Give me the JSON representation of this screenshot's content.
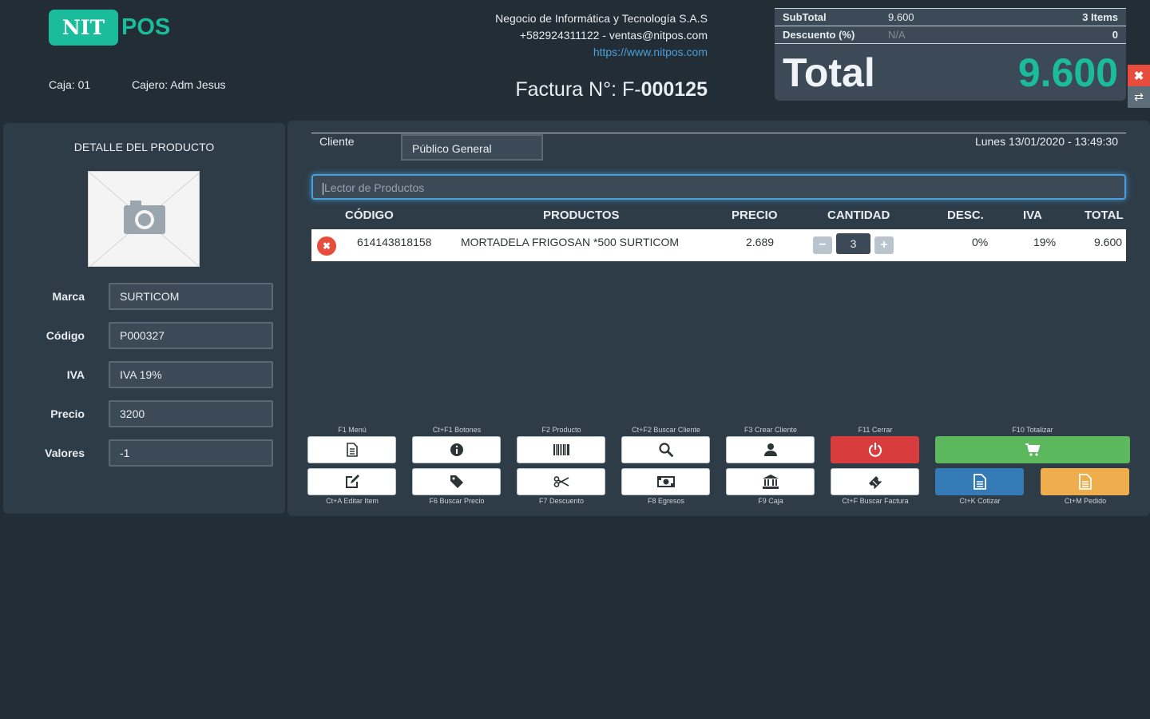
{
  "header": {
    "logo_left": "NIT",
    "logo_right": "POS",
    "caja": "Caja: 01",
    "cajero": "Cajero: Adm Jesus",
    "company_name": "Negocio de Informática y Tecnología S.A.S",
    "company_contact": "+582924311122 - ventas@nitpos.com",
    "company_url": "https://www.nitpos.com",
    "factura_prefix": "Factura N°: F-",
    "factura_number": "000125"
  },
  "totals": {
    "subtotal_label": "SubTotal",
    "subtotal_value": "9.600",
    "items_count": "3 Items",
    "discount_label": "Descuento (%)",
    "discount_value": "N/A",
    "discount_amount": "0",
    "total_label": "Total",
    "total_value": "9.600"
  },
  "product_detail": {
    "title": "DETALLE DEL PRODUCTO",
    "fields": [
      {
        "label": "Marca",
        "value": "SURTICOM"
      },
      {
        "label": "Código",
        "value": "P000327"
      },
      {
        "label": "IVA",
        "value": "IVA 19%"
      },
      {
        "label": "Precio",
        "value": "3200"
      },
      {
        "label": "Valores",
        "value": "-1"
      }
    ]
  },
  "sale": {
    "client_label": "Cliente",
    "client_value": "Público General",
    "datetime": "Lunes 13/01/2020 - 13:49:30",
    "scanner_placeholder": "Lector de Productos",
    "columns": [
      "CÓDIGO",
      "PRODUCTOS",
      "PRECIO",
      "CANTIDAD",
      "DESC.",
      "IVA",
      "TOTAL"
    ],
    "rows": [
      {
        "code": "614143818158",
        "product": "MORTADELA FRIGOSAN *500 SURTICOM",
        "price": "2.689",
        "qty": "3",
        "desc": "0%",
        "iva": "19%",
        "total": "9.600"
      }
    ]
  },
  "shortcuts": {
    "top": [
      "F1 Menú",
      "Ct+F1 Botones",
      "F2 Producto",
      "Ct+F2 Buscar Cliente",
      "F3 Crear Cliente",
      "F11 Cerrar",
      "F10 Totalizar"
    ],
    "bottom": [
      "Ct+A Editar Item",
      "F6 Buscar Precio",
      "F7 Descuento",
      "F8 Egresos",
      "F9 Caja",
      "Ct+F Buscar Factura",
      "Ct+K Cotizar",
      "Ct+M Pedido"
    ]
  },
  "colors": {
    "accent": "#1abc9c",
    "danger": "#d93c3c",
    "success": "#5cb85c",
    "primary": "#337ab7",
    "warning": "#f0ad4e",
    "background": "#232d36",
    "panel": "#2e3c48"
  },
  "icons": [
    "document-icon",
    "info-icon",
    "barcode-icon",
    "search-icon",
    "user-icon",
    "power-icon",
    "cart-icon",
    "edit-icon",
    "tag-icon",
    "scissors-icon",
    "money-icon",
    "bank-icon",
    "ticket-icon",
    "file-text-icon",
    "camera-icon",
    "close-icon",
    "shuffle-icon",
    "minus-icon",
    "plus-icon"
  ]
}
